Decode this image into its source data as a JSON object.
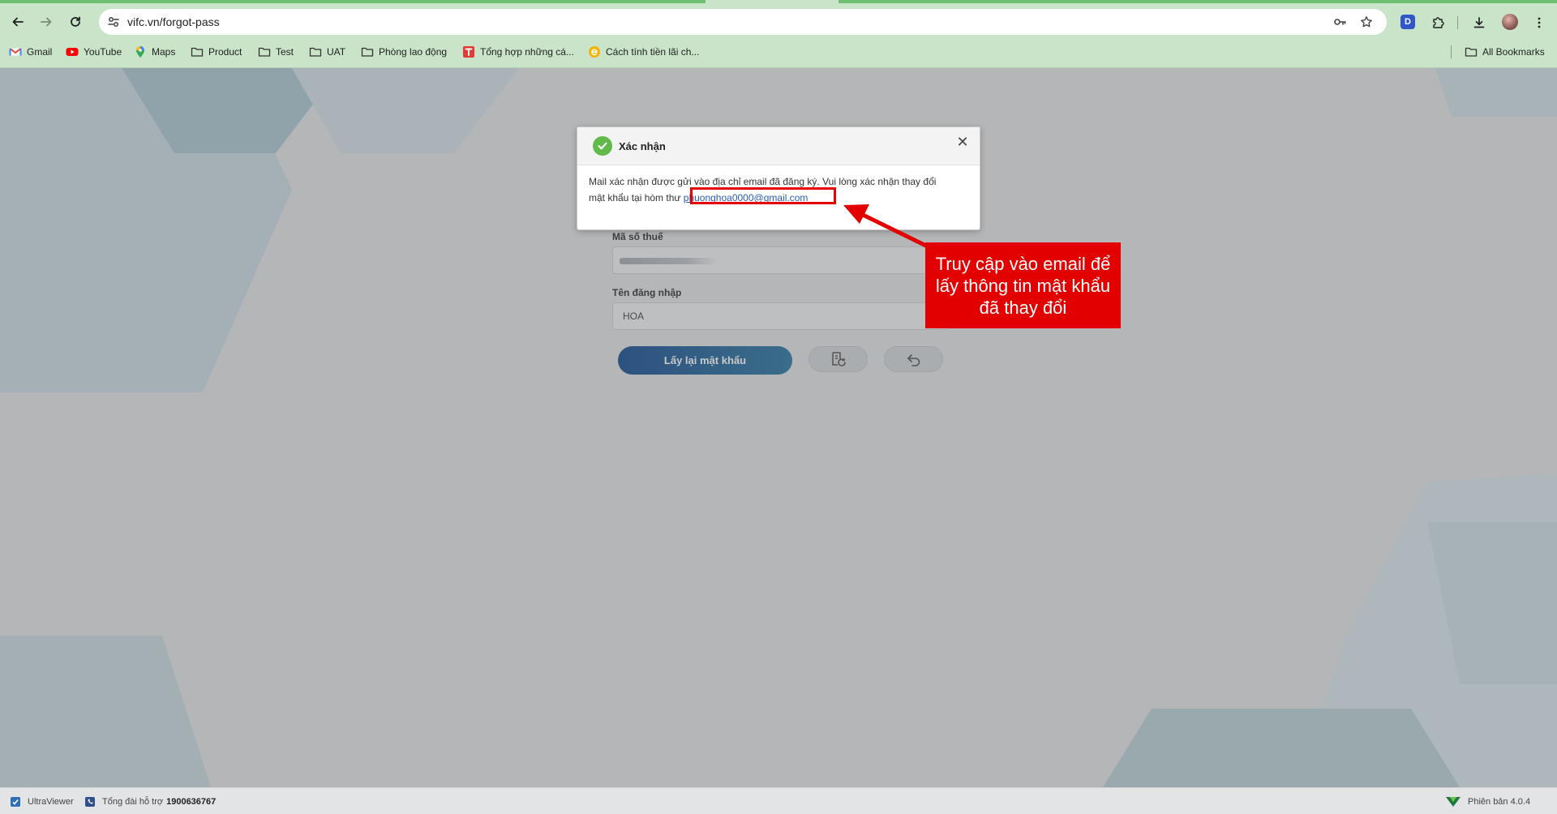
{
  "browser": {
    "url": "vifc.vn/forgot-pass",
    "bookmarks": [
      "Gmail",
      "YouTube",
      "Maps",
      "Product",
      "Test",
      "UAT",
      "Phòng lao động",
      "Tổng hợp những cá...",
      "Cách tính tiền lãi ch..."
    ],
    "all_bookmarks": "All Bookmarks",
    "extension_letter": "D"
  },
  "form": {
    "tax_code_label": "Mã số thuế",
    "username_label": "Tên đăng nhập",
    "username_value": "HOA",
    "submit_label": "Lấy lại mật khẩu"
  },
  "modal": {
    "title": "Xác nhận",
    "message_line1": "Mail xác nhận được gửi vào địa chỉ email đã đăng ký. Vui lòng xác nhận thay đổi",
    "message_line2": "mật khẩu tại hòm thư",
    "email": "phuonghoa0000@gmail.com"
  },
  "annotation": {
    "text": "Truy cập vào email để lấy thông tin mật khẩu đã thay đổi"
  },
  "footer": {
    "app_name": "UltraViewer",
    "hotline_label": "Tổng đài hỗ trợ",
    "hotline_number": "1900636767",
    "version": "Phiên bản 4.0.4"
  },
  "colors": {
    "accent": "#06408c",
    "annotation": "#e20000",
    "success": "#61b94a"
  }
}
